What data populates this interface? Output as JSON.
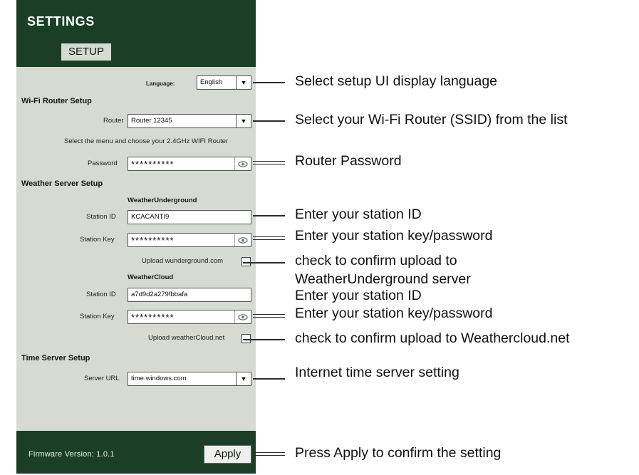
{
  "header": {
    "title": "SETTINGS",
    "tab": "SETUP"
  },
  "language": {
    "label": "Language:",
    "value": "English"
  },
  "wifi": {
    "section": "Wi-Fi Router Setup",
    "router_label": "Router",
    "router_value": "Router 12345",
    "hint": "Select the menu and choose your 2.4GHz WIFI Router",
    "password_label": "Password",
    "password_value": "**********"
  },
  "weather": {
    "section": "Weather Server Setup",
    "wu": {
      "title": "WeatherUnderground",
      "station_id_label": "Station ID",
      "station_id_value": "KCACANTI9",
      "station_key_label": "Station Key",
      "station_key_value": "**********",
      "upload_label": "Upload wunderground.com"
    },
    "wc": {
      "title": "WeatherCloud",
      "station_id_label": "Station ID",
      "station_id_value": "a7d9d2a279fbbafa",
      "station_key_label": "Station Key",
      "station_key_value": "**********",
      "upload_label": "Upload weatherCloud.net"
    }
  },
  "time": {
    "section": "Time Server Setup",
    "server_label": "Server URL",
    "server_value": "time.windows.com"
  },
  "footer": {
    "firmware": "Firmware Version:  1.0.1",
    "apply": "Apply"
  },
  "icons": {
    "dropdown": "chevron-down-icon",
    "eye": "eye-icon"
  },
  "annotations": {
    "language": "Select setup UI display language",
    "router": "Select your Wi-Fi Router (SSID) from the list",
    "password": "Router Password",
    "wu_station_id": "Enter your station ID",
    "wu_station_key": "Enter your station key/password",
    "wu_upload_1": "check to confirm upload to",
    "wu_upload_2": "WeatherUnderground server",
    "wc_station_id": "Enter your station ID",
    "wc_station_key": "Enter your station key/password",
    "wc_upload": "check to confirm upload to Weathercloud.net",
    "time_server": "Internet time server setting",
    "apply": "Press Apply to confirm the setting"
  },
  "colors": {
    "panel_bg": "#d5dbd3",
    "header_bg": "#1a3f25",
    "field_bg": "#ffffff"
  }
}
